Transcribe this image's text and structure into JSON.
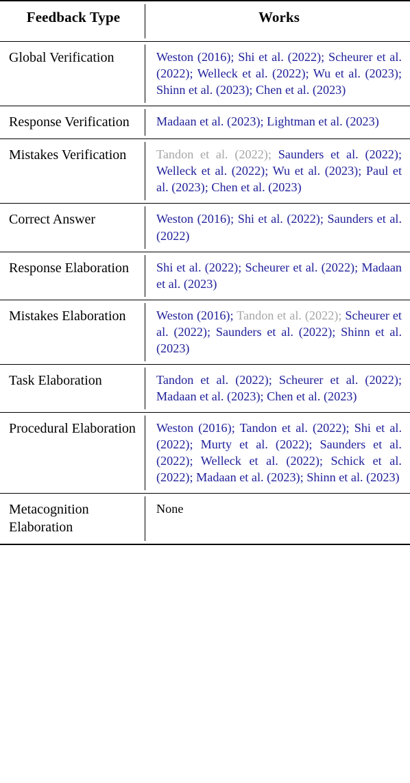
{
  "table": {
    "columns": [
      {
        "key": "feedback_type",
        "header": "Feedback Type"
      },
      {
        "key": "works",
        "header": "Works"
      }
    ],
    "colors": {
      "citation_blue": "#21219b",
      "citation_dim_gray": "#a6a6a6",
      "text_black": "#000000",
      "rule_black": "#000000",
      "background": "#ffffff"
    },
    "rows": [
      {
        "feedback_type": "Global Verification",
        "works": "Weston (2016); Shi et al. (2022); Scheurer et al. (2022); Welleck et al. (2022); Wu et al. (2023); Shinn et al. (2023); Chen et al. (2023)",
        "citations": [
          {
            "text": "Weston (2016)",
            "style": "blue"
          },
          {
            "text": "Shi et al. (2022)",
            "style": "blue"
          },
          {
            "text": "Scheurer et al. (2022)",
            "style": "blue"
          },
          {
            "text": "Welleck et al. (2022)",
            "style": "blue"
          },
          {
            "text": "Wu et al. (2023)",
            "style": "blue"
          },
          {
            "text": "Shinn et al. (2023)",
            "style": "blue"
          },
          {
            "text": "Chen et al. (2023)",
            "style": "blue"
          }
        ]
      },
      {
        "feedback_type": "Response Verification",
        "works": "Madaan et al. (2023); Lightman et al. (2023)",
        "citations": [
          {
            "text": "Madaan et al. (2023)",
            "style": "blue"
          },
          {
            "text": "Lightman et al. (2023)",
            "style": "blue"
          }
        ]
      },
      {
        "feedback_type": "Mistakes Verification",
        "works": "Tandon et al. (2022); Saunders et al. (2022); Welleck et al. (2022); Wu et al. (2023); Paul et al. (2023); Chen et al. (2023)",
        "citations": [
          {
            "text": "Tandon et al. (2022)",
            "style": "dim"
          },
          {
            "text": "Saunders et al. (2022)",
            "style": "blue"
          },
          {
            "text": "Welleck et al. (2022)",
            "style": "blue"
          },
          {
            "text": "Wu et al. (2023)",
            "style": "blue"
          },
          {
            "text": "Paul et al. (2023)",
            "style": "blue"
          },
          {
            "text": "Chen et al. (2023)",
            "style": "blue"
          }
        ]
      },
      {
        "feedback_type": "Correct Answer",
        "works": "Weston (2016); Shi et al. (2022); Saunders et al. (2022)",
        "citations": [
          {
            "text": "Weston (2016)",
            "style": "blue"
          },
          {
            "text": "Shi et al. (2022)",
            "style": "blue"
          },
          {
            "text": "Saunders et al. (2022)",
            "style": "blue"
          }
        ]
      },
      {
        "feedback_type": "Response Elaboration",
        "works": "Shi et al. (2022); Scheurer et al. (2022); Madaan et al. (2023)",
        "citations": [
          {
            "text": "Shi et al. (2022)",
            "style": "blue"
          },
          {
            "text": "Scheurer et al. (2022)",
            "style": "blue"
          },
          {
            "text": "Madaan et al. (2023)",
            "style": "blue"
          }
        ]
      },
      {
        "feedback_type": "Mistakes Elaboration",
        "works": "Weston (2016); Tandon et al. (2022); Scheurer et al. (2022); Saunders et al. (2022); Shinn et al. (2023)",
        "citations": [
          {
            "text": "Weston (2016)",
            "style": "blue"
          },
          {
            "text": "Tandon et al. (2022)",
            "style": "dim"
          },
          {
            "text": "Scheurer et al. (2022)",
            "style": "blue"
          },
          {
            "text": "Saunders et al. (2022)",
            "style": "blue"
          },
          {
            "text": "Shinn et al. (2023)",
            "style": "blue"
          }
        ]
      },
      {
        "feedback_type": "Task Elaboration",
        "works": "Tandon et al. (2022); Scheurer et al. (2022); Madaan et al. (2023); Chen et al. (2023)",
        "citations": [
          {
            "text": "Tandon et al. (2022)",
            "style": "blue"
          },
          {
            "text": "Scheurer et al. (2022)",
            "style": "blue"
          },
          {
            "text": "Madaan et al. (2023)",
            "style": "blue"
          },
          {
            "text": "Chen et al. (2023)",
            "style": "blue"
          }
        ]
      },
      {
        "feedback_type": "Procedural Elaboration",
        "works": "Weston (2016); Tandon et al. (2022); Shi et al. (2022); Murty et al. (2022); Saunders et al. (2022); Welleck et al. (2022); Schick et al. (2022); Madaan et al. (2023); Shinn et al. (2023)",
        "citations": [
          {
            "text": "Weston (2016)",
            "style": "blue"
          },
          {
            "text": "Tandon et al. (2022)",
            "style": "blue"
          },
          {
            "text": "Shi et al. (2022)",
            "style": "blue"
          },
          {
            "text": "Murty et al. (2022)",
            "style": "blue"
          },
          {
            "text": "Saunders et al. (2022)",
            "style": "blue"
          },
          {
            "text": "Welleck et al. (2022)",
            "style": "blue"
          },
          {
            "text": "Schick et al. (2022)",
            "style": "blue"
          },
          {
            "text": "Madaan et al. (2023)",
            "style": "blue"
          },
          {
            "text": "Shinn et al. (2023)",
            "style": "blue"
          }
        ]
      },
      {
        "feedback_type": "Metacognition Elaboration",
        "works": "None",
        "citations": [
          {
            "text": "None",
            "style": "plain"
          }
        ]
      }
    ]
  }
}
